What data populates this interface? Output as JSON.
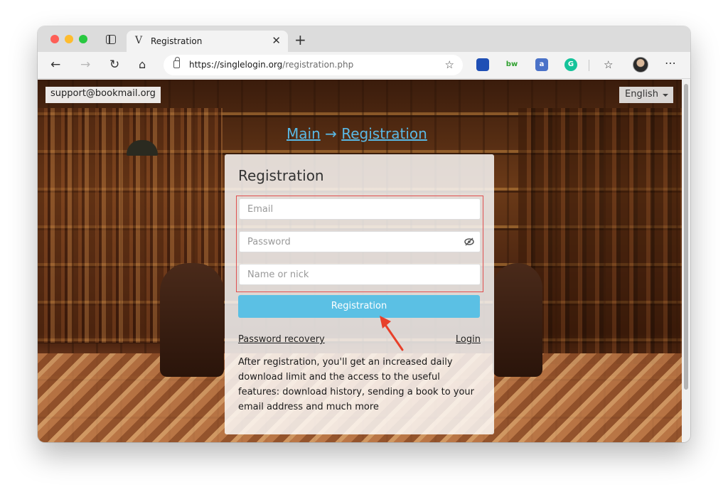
{
  "browser": {
    "tab": {
      "favicon": "V",
      "title": "Registration"
    },
    "address": {
      "host": "https://singlelogin.org",
      "path": "/registration.php"
    },
    "icons": [
      "sidebar-icon",
      "back-icon",
      "forward-icon",
      "refresh-icon",
      "home-icon",
      "lock-icon",
      "favorite-star-icon",
      "extension-icon",
      "favorites-icon",
      "more-icon"
    ],
    "extensions": [
      {
        "label": "",
        "color": "#1f4fb5"
      },
      {
        "label": "bw",
        "color": "#2fa02f"
      },
      {
        "label": "a",
        "color": "#4a72c8"
      },
      {
        "label": "G",
        "color": "#15c39a"
      }
    ]
  },
  "page": {
    "support_email": "support@bookmail.org",
    "language": "English",
    "breadcrumb": {
      "main": "Main",
      "arrow": "→",
      "current": "Registration"
    },
    "form": {
      "title": "Registration",
      "email_placeholder": "Email",
      "password_placeholder": "Password",
      "name_placeholder": "Name or nick",
      "submit_label": "Registration",
      "recovery_link": "Password recovery",
      "login_link": "Login",
      "info": "After registration, you'll get an increased daily download limit and the access to the useful features: download history, sending a book to your email address and much more"
    },
    "accent_color": "#5bc0e4",
    "highlight_color": "#e05050"
  }
}
